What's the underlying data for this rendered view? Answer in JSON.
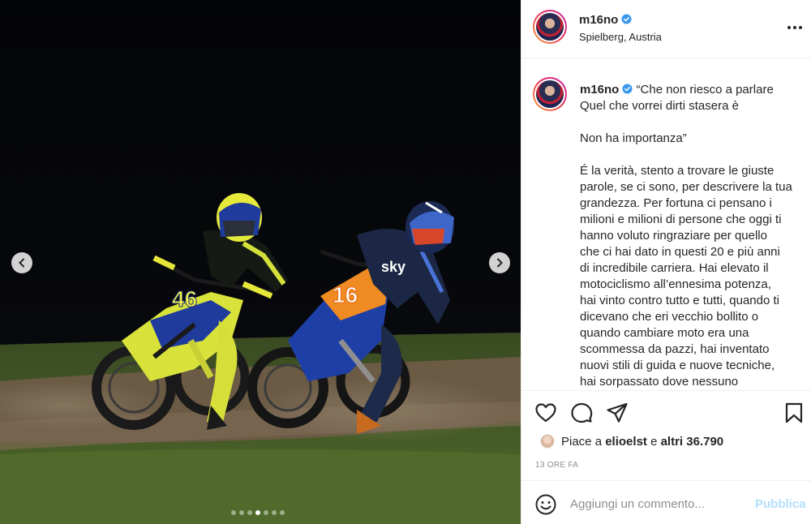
{
  "post": {
    "username": "m16no",
    "verified": true,
    "location": "Spielberg, Austria",
    "caption_first_line": "“Che non riesco a parlare",
    "caption_lines": [
      "Quel che vorrei dirti stasera è",
      "",
      "Non ha importanza”",
      "",
      "É la verità, stento a trovare le giuste",
      "parole, se ci sono, per descrivere la tua",
      "grandezza. Per fortuna ci pensano i",
      "milioni e milioni di persone che oggi ti",
      "hanno voluto ringraziare per quello",
      "che ci hai dato in questi 20 e più anni",
      "di incredibile carriera. Hai elevato il",
      "motociclismo all’ennesima potenza,",
      "hai vinto contro tutto e tutti, quando ti",
      "dicevano che eri vecchio bollito o",
      "quando cambiare moto era una",
      "scommessa da pazzi, hai inventato",
      "nuovi stili di guida e nuove tecniche,",
      "hai sorpassato dove nessuno"
    ]
  },
  "likes": {
    "prefix": "Piace a ",
    "user": "elioelst",
    "connector": " e ",
    "others": "altri 36.790"
  },
  "timestamp": "13 ORE FA",
  "comment_box": {
    "placeholder": "Aggiungi un commento...",
    "publish_label": "Pubblica"
  },
  "carousel": {
    "total": 7,
    "active_index": 3
  },
  "photo": {
    "rider_left_number": "46",
    "rider_right_number": "16",
    "sponsor_text": "sky"
  },
  "colors": {
    "verified": "#3897f0",
    "publish_disabled": "#b2dffc",
    "muted_text": "#8e8e8e",
    "border": "#efefef"
  }
}
